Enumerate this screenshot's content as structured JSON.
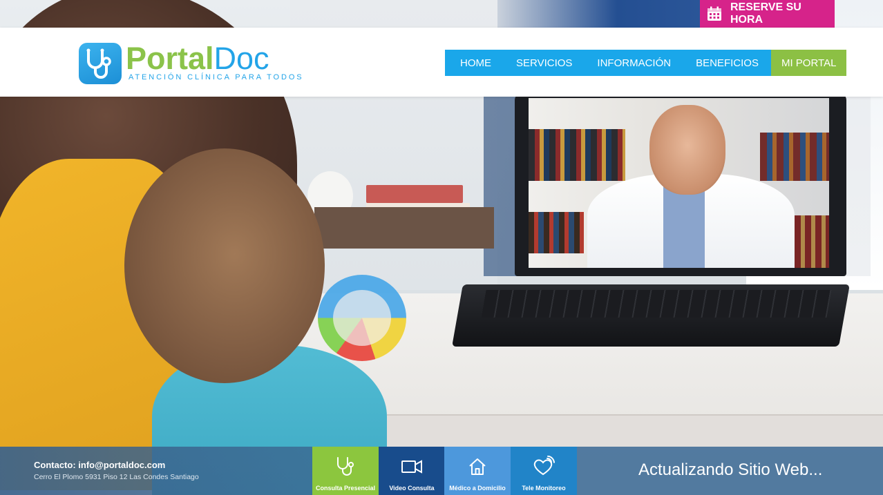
{
  "reserve": {
    "label": "RESERVE SU HORA"
  },
  "logo": {
    "part1": "Portal",
    "part2": "Doc",
    "tagline": "ATENCIÓN CLÍNICA PARA TODOS"
  },
  "nav": {
    "items": [
      "HOME",
      "SERVICIOS",
      "INFORMACIÓN",
      "BENEFICIOS"
    ],
    "portal": "MI PORTAL"
  },
  "footer": {
    "contact": "Contacto: info@portaldoc.com",
    "address": "Cerro El Plomo 5931 Piso 12 Las Condes Santiago",
    "services": [
      {
        "label": "Consulta Presencial",
        "icon": "stethoscope-icon"
      },
      {
        "label": "Video Consulta",
        "icon": "video-camera-icon"
      },
      {
        "label": "Médico a Domicilio",
        "icon": "home-icon"
      },
      {
        "label": "Tele Monitoreo",
        "icon": "heart-signal-icon"
      }
    ],
    "status": "Actualizando Sitio Web..."
  },
  "colors": {
    "reserve": "#d6238a",
    "nav": "#1aa7ea",
    "portal": "#8cc044",
    "logo_green": "#8bc34a",
    "logo_blue": "#23a4e8"
  }
}
